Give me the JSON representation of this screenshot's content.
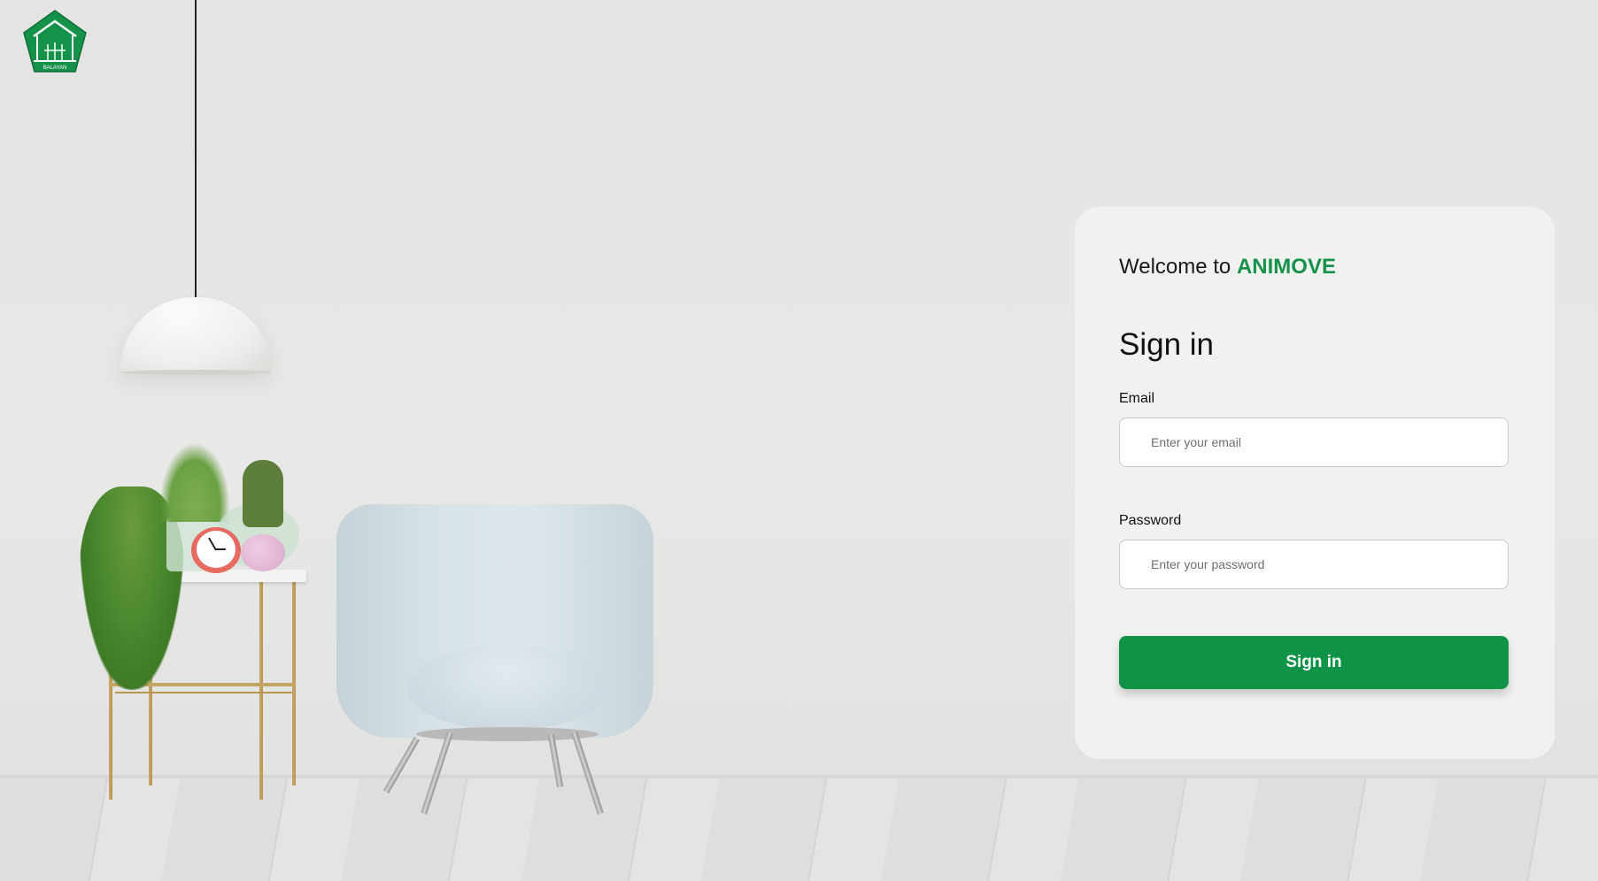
{
  "brand": {
    "logo_icon": "balayan-house-logo-icon",
    "logo_text": "BALAYAN",
    "accent_color": "#0f9447"
  },
  "login": {
    "welcome_prefix": "Welcome to",
    "app_name": "ANIMOVE",
    "title": "Sign in",
    "email_label": "Email",
    "email_placeholder": "Enter your email",
    "email_value": "",
    "password_label": "Password",
    "password_placeholder": "Enter your password",
    "password_value": "",
    "submit_label": "Sign in"
  }
}
